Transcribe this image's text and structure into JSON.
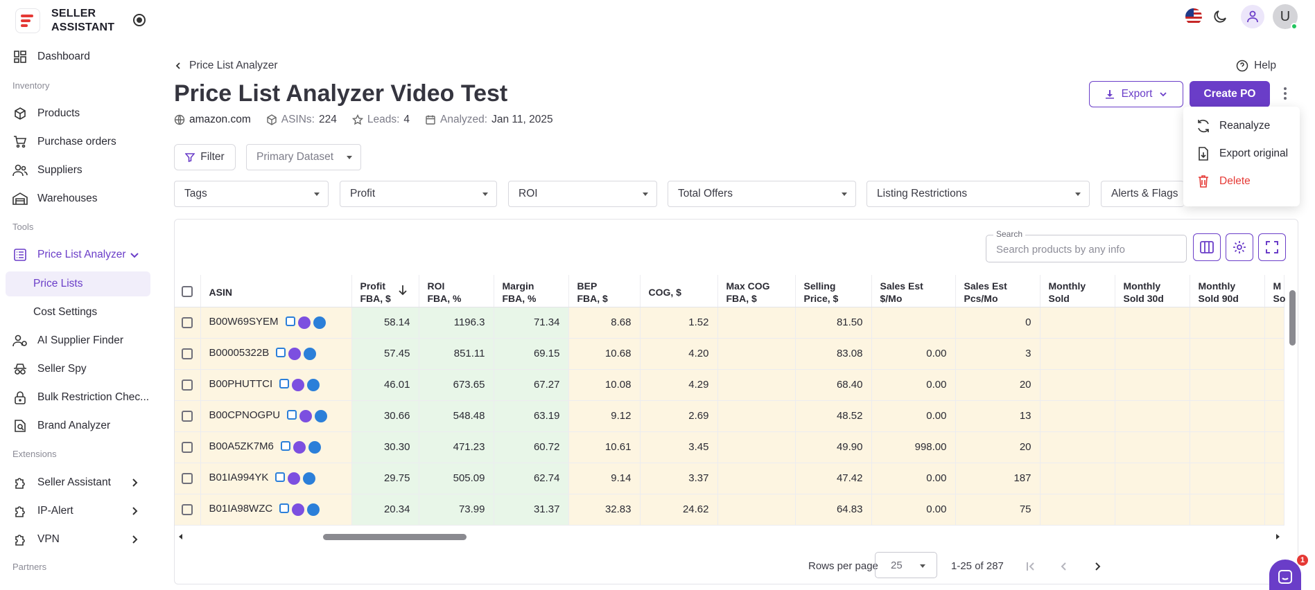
{
  "brand": {
    "name_line1": "SELLER",
    "name_line2": "ASSISTANT"
  },
  "sidebar": {
    "dashboard": "Dashboard",
    "section_inventory": "Inventory",
    "products": "Products",
    "purchase_orders": "Purchase orders",
    "suppliers": "Suppliers",
    "warehouses": "Warehouses",
    "section_tools": "Tools",
    "price_list_analyzer": "Price List Analyzer",
    "price_lists": "Price Lists",
    "cost_settings": "Cost Settings",
    "ai_supplier_finder": "AI Supplier Finder",
    "seller_spy": "Seller Spy",
    "bulk_restriction": "Bulk Restriction Chec...",
    "brand_analyzer": "Brand Analyzer",
    "section_extensions": "Extensions",
    "seller_assistant": "Seller Assistant",
    "ip_alert": "IP-Alert",
    "vpn": "VPN",
    "section_partners": "Partners"
  },
  "topbar": {
    "avatar_letter": "U"
  },
  "header": {
    "breadcrumb": "Price List Analyzer",
    "title": "Price List Analyzer Video Test",
    "help": "Help",
    "marketplace": "amazon.com",
    "asins_label": "ASINs:",
    "asins_value": "224",
    "leads_label": "Leads:",
    "leads_value": "4",
    "analyzed_label": "Analyzed:",
    "analyzed_value": "Jan 11, 2025",
    "export": "Export",
    "create_po": "Create PO"
  },
  "menu": {
    "reanalyze": "Reanalyze",
    "export_original": "Export original",
    "delete": "Delete"
  },
  "filters": {
    "filter": "Filter",
    "dataset": "Primary Dataset",
    "tags": "Tags",
    "profit": "Profit",
    "roi": "ROI",
    "total_offers": "Total Offers",
    "listing_restrictions": "Listing Restrictions",
    "alerts_flags": "Alerts & Flags"
  },
  "search": {
    "label": "Search",
    "placeholder": "Search products by any info"
  },
  "table": {
    "headers": [
      {
        "l1": "ASIN",
        "l2": ""
      },
      {
        "l1": "Profit",
        "l2": "FBA, $"
      },
      {
        "l1": "ROI",
        "l2": "FBA, %"
      },
      {
        "l1": "Margin",
        "l2": "FBA, %"
      },
      {
        "l1": "BEP",
        "l2": "FBA, $"
      },
      {
        "l1": "COG, $",
        "l2": ""
      },
      {
        "l1": "Max COG",
        "l2": "FBA, $"
      },
      {
        "l1": "Selling",
        "l2": "Price, $"
      },
      {
        "l1": "Sales Est",
        "l2": "$/Mo"
      },
      {
        "l1": "Sales Est",
        "l2": "Pcs/Mo"
      },
      {
        "l1": "Monthly",
        "l2": "Sold"
      },
      {
        "l1": "Monthly",
        "l2": "Sold 30d"
      },
      {
        "l1": "Monthly",
        "l2": "Sold 90d"
      },
      {
        "l1": "M",
        "l2": "So"
      }
    ],
    "rows": [
      [
        "B00W69SYEM",
        "58.14",
        "1196.3",
        "71.34",
        "8.68",
        "1.52",
        "",
        "81.50",
        "",
        "0"
      ],
      [
        "B00005322B",
        "57.45",
        "851.11",
        "69.15",
        "10.68",
        "4.20",
        "",
        "83.08",
        "0.00",
        "3"
      ],
      [
        "B00PHUTTCI",
        "46.01",
        "673.65",
        "67.27",
        "10.08",
        "4.29",
        "",
        "68.40",
        "0.00",
        "20"
      ],
      [
        "B00CPNOGPU",
        "30.66",
        "548.48",
        "63.19",
        "9.12",
        "2.69",
        "",
        "48.52",
        "0.00",
        "13"
      ],
      [
        "B00A5ZK7M6",
        "30.30",
        "471.23",
        "60.72",
        "10.61",
        "3.45",
        "",
        "49.90",
        "998.00",
        "20"
      ],
      [
        "B01IA994YK",
        "29.75",
        "505.09",
        "62.74",
        "9.14",
        "3.37",
        "",
        "47.42",
        "0.00",
        "187"
      ],
      [
        "B01IA98WZC",
        "20.34",
        "73.99",
        "31.37",
        "32.83",
        "24.62",
        "",
        "64.83",
        "0.00",
        "75"
      ]
    ]
  },
  "pagination": {
    "rows_label": "Rows per page",
    "rows_value": "25",
    "range": "1-25 of 287"
  },
  "chat": {
    "badge": "1"
  }
}
